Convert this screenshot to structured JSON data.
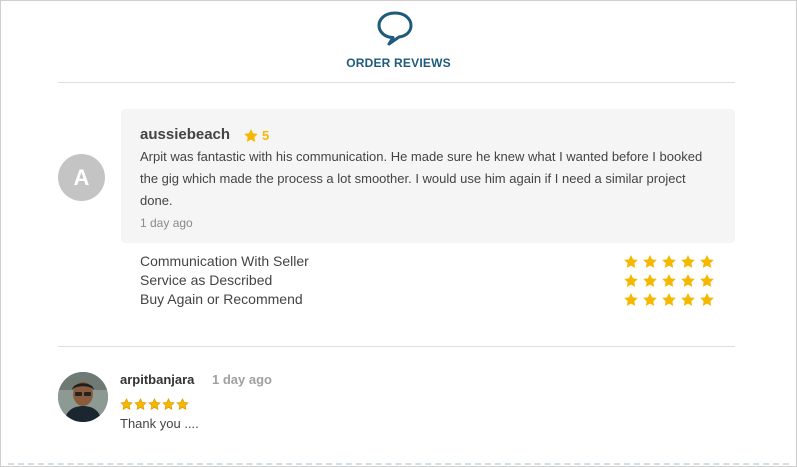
{
  "colors": {
    "accent": "#1e5a7c",
    "star": "#f5b800",
    "card_bg": "#f5f5f5",
    "avatar_bg": "#c4c4c4"
  },
  "header": {
    "icon": "chat-bubble-icon",
    "title": "ORDER REVIEWS"
  },
  "review": {
    "avatar_initial": "A",
    "reviewer": "aussiebeach",
    "rating": "5",
    "text": "Arpit was fantastic with his communication. He made sure he knew what I wanted before I booked the gig which made the process a lot smoother. I would use him again if I need a similar project done.",
    "time": "1 day ago",
    "criteria": [
      {
        "label": "Communication With Seller",
        "stars": 5
      },
      {
        "label": "Service as Described",
        "stars": 5
      },
      {
        "label": "Buy Again or Recommend",
        "stars": 5
      }
    ]
  },
  "reply": {
    "name": "arpitbanjara",
    "time": "1 day ago",
    "stars": 5,
    "text": "Thank you ...."
  }
}
